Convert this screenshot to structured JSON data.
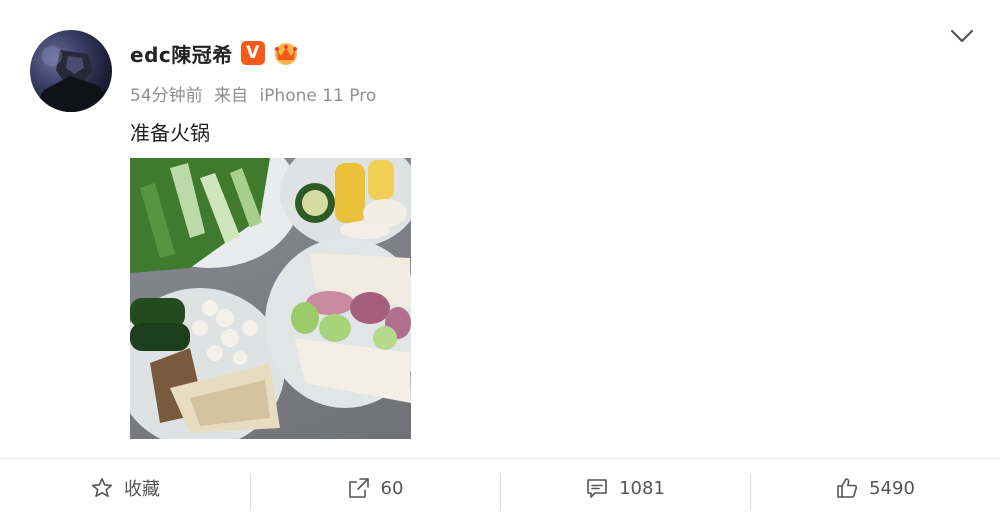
{
  "post": {
    "username": "edc陳冠希",
    "verified_badge": "V",
    "time": "54分钟前",
    "source_prefix": "来自",
    "source_device": "iPhone 11 Pro",
    "text": "准备火锅",
    "icons": {
      "avatar": "avatar-image",
      "verified": "verified-v-icon",
      "member": "crown-member-icon",
      "menu": "chevron-down-icon",
      "photo": "hotpot-ingredients-photo"
    }
  },
  "actions": {
    "favorite_label": "收藏",
    "repost_count": "60",
    "comment_count": "1081",
    "like_count": "5490"
  },
  "colors": {
    "verified_orange": "#f65a18",
    "meta_gray": "#8f8f8f",
    "divider": "#ececec"
  }
}
